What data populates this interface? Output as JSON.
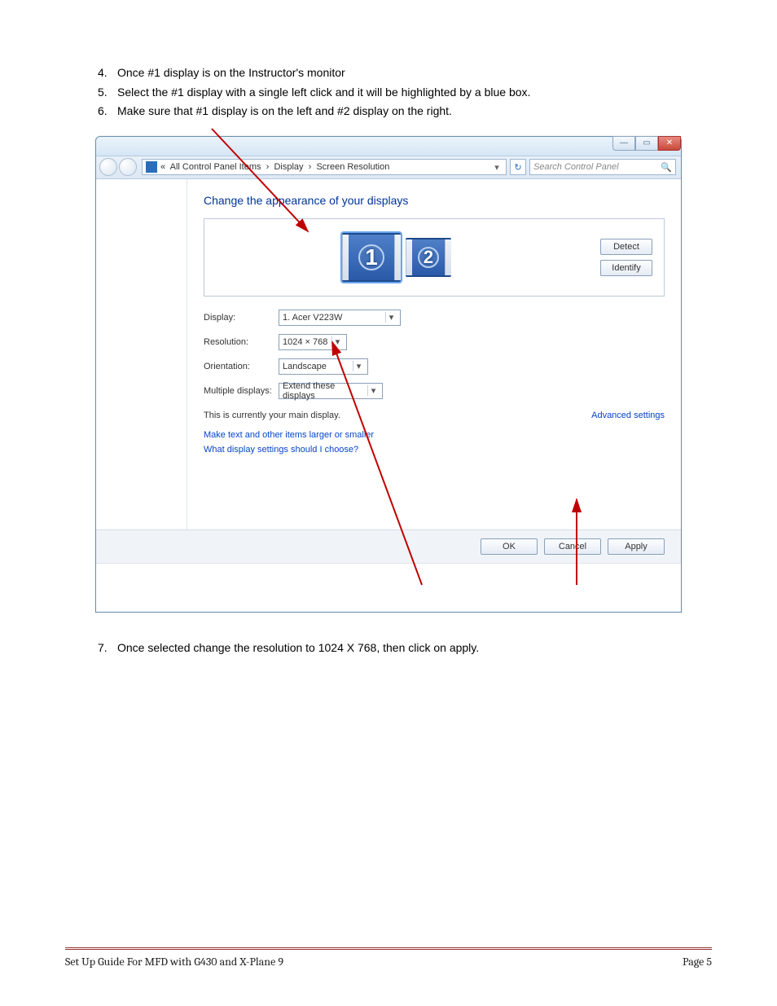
{
  "steps": {
    "s4_num": "4.",
    "s4_text": "Once #1 display is on the Instructor's monitor",
    "s5_num": "5.",
    "s5_text": "Select the #1 display with a single left click and it will be highlighted by a blue box.",
    "s6_num": "6.",
    "s6_text": "Make sure that #1 display is on the left and #2 display on the right.",
    "s7_num": "7.",
    "s7_text": "Once selected change the resolution to 1024 X 768, then click on apply."
  },
  "breadcrumb": {
    "prefix": "«",
    "item1": "All Control Panel Items",
    "item2": "Display",
    "item3": "Screen Resolution",
    "sep": "›"
  },
  "search_placeholder": "Search Control Panel",
  "heading": "Change the appearance of your displays",
  "monitors": {
    "one": "1",
    "two": "2"
  },
  "buttons": {
    "detect": "Detect",
    "identify": "Identify",
    "ok": "OK",
    "cancel": "Cancel",
    "apply": "Apply"
  },
  "labels": {
    "display": "Display:",
    "resolution": "Resolution:",
    "orientation": "Orientation:",
    "multiple": "Multiple displays:"
  },
  "values": {
    "display": "1. Acer V223W",
    "resolution": "1024 × 768",
    "orientation": "Landscape",
    "multiple": "Extend these displays"
  },
  "main_display_text": "This is currently your main display.",
  "advanced_link": "Advanced settings",
  "link1": "Make text and other items larger or smaller",
  "link2": "What display settings should I choose?",
  "footer": {
    "left": "Set Up Guide For MFD with G430 and X-Plane 9",
    "right": "Page 5"
  }
}
